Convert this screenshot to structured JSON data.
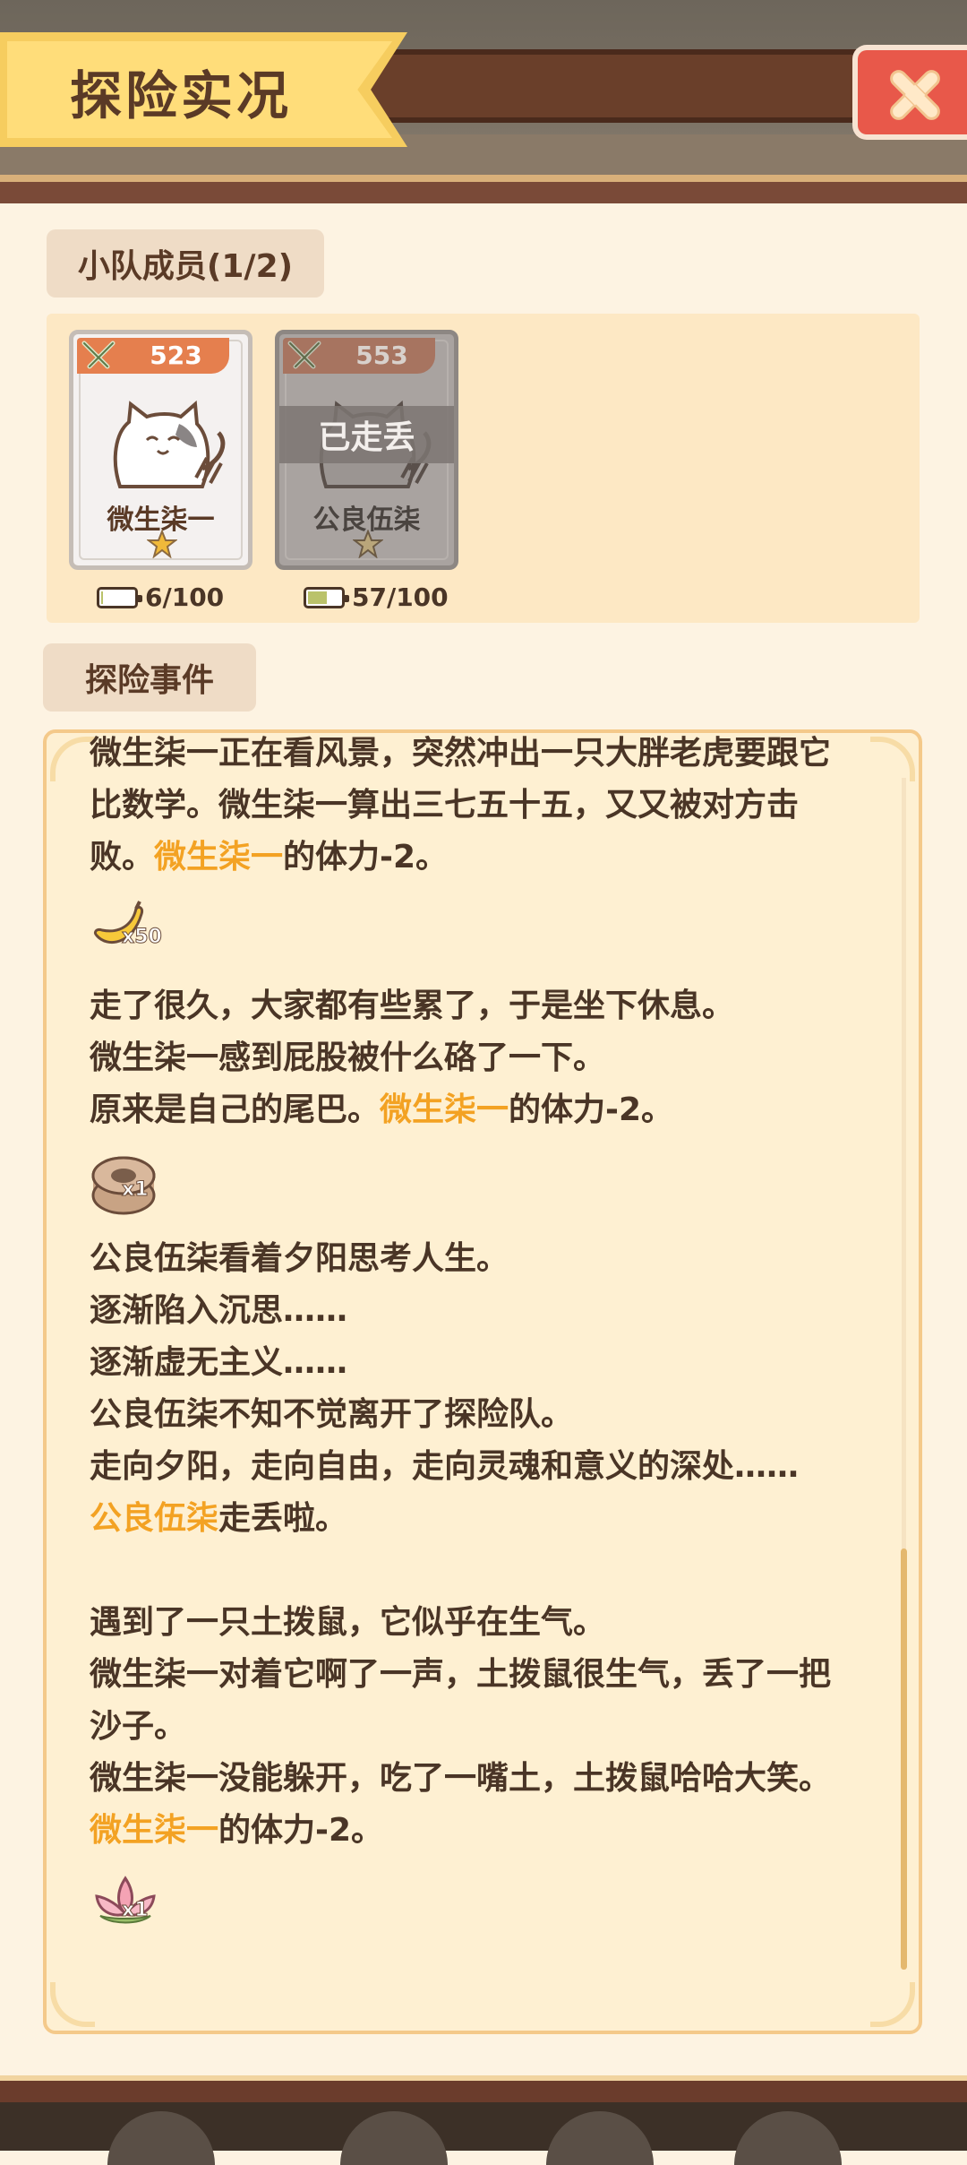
{
  "header": {
    "title": "探险实况",
    "close_icon": "close-x-icon"
  },
  "team": {
    "label": "小队成员(1/2)",
    "members": [
      {
        "power": "523",
        "name": "微生柒一",
        "stars": 1,
        "stamina": "6/100",
        "stamina_fraction": 0.06,
        "status": ""
      },
      {
        "power": "553",
        "name": "公良伍柒",
        "stars": 1,
        "stamina": "57/100",
        "stamina_fraction": 0.57,
        "status": "已走丢"
      }
    ]
  },
  "events": {
    "label": "探险事件",
    "highlight_color": "#f3a223",
    "entries": [
      {
        "lines": [
          {
            "parts": [
              {
                "t": "微生柒一正在看风景，突然冲出一只大胖老虎要跟它比数学。微生柒一算出三七五十五，又又被对方击败。"
              },
              {
                "t": "微生柒一",
                "hl": true
              },
              {
                "t": "的体力-2。"
              }
            ]
          }
        ],
        "reward": {
          "icon": "banana-icon",
          "qty": "x50"
        }
      },
      {
        "lines": [
          {
            "parts": [
              {
                "t": "走了很久，大家都有些累了，于是坐下休息。"
              }
            ]
          },
          {
            "parts": [
              {
                "t": "微生柒一感到屁股被什么硌了一下。"
              }
            ]
          },
          {
            "parts": [
              {
                "t": "原来是自己的尾巴。"
              },
              {
                "t": "微生柒一",
                "hl": true
              },
              {
                "t": "的体力-2。"
              }
            ]
          }
        ],
        "reward": {
          "icon": "tape-roll-icon",
          "qty": "x1"
        }
      },
      {
        "lines": [
          {
            "parts": [
              {
                "t": "公良伍柒看着夕阳思考人生。"
              }
            ]
          },
          {
            "parts": [
              {
                "t": "逐渐陷入沉思……"
              }
            ]
          },
          {
            "parts": [
              {
                "t": "逐渐虚无主义……"
              }
            ]
          },
          {
            "parts": [
              {
                "t": "公良伍柒不知不觉离开了探险队。"
              }
            ]
          },
          {
            "parts": [
              {
                "t": "走向夕阳，走向自由，走向灵魂和意义的深处……"
              }
            ]
          },
          {
            "parts": [
              {
                "t": "公良伍柒",
                "hl": true
              },
              {
                "t": "走丢啦。"
              }
            ]
          }
        ]
      },
      {
        "lines": [
          {
            "parts": [
              {
                "t": "遇到了一只土拨鼠，它似乎在生气。"
              }
            ]
          },
          {
            "parts": [
              {
                "t": "微生柒一对着它啊了一声，土拨鼠很生气，丢了一把沙子。"
              }
            ]
          },
          {
            "parts": [
              {
                "t": "微生柒一没能躲开，吃了一嘴土，土拨鼠哈哈大笑。"
              },
              {
                "t": "微生柒一",
                "hl": true
              },
              {
                "t": "的体力-2。"
              }
            ]
          }
        ],
        "reward": {
          "icon": "lotus-icon",
          "qty": "x1"
        }
      }
    ]
  }
}
